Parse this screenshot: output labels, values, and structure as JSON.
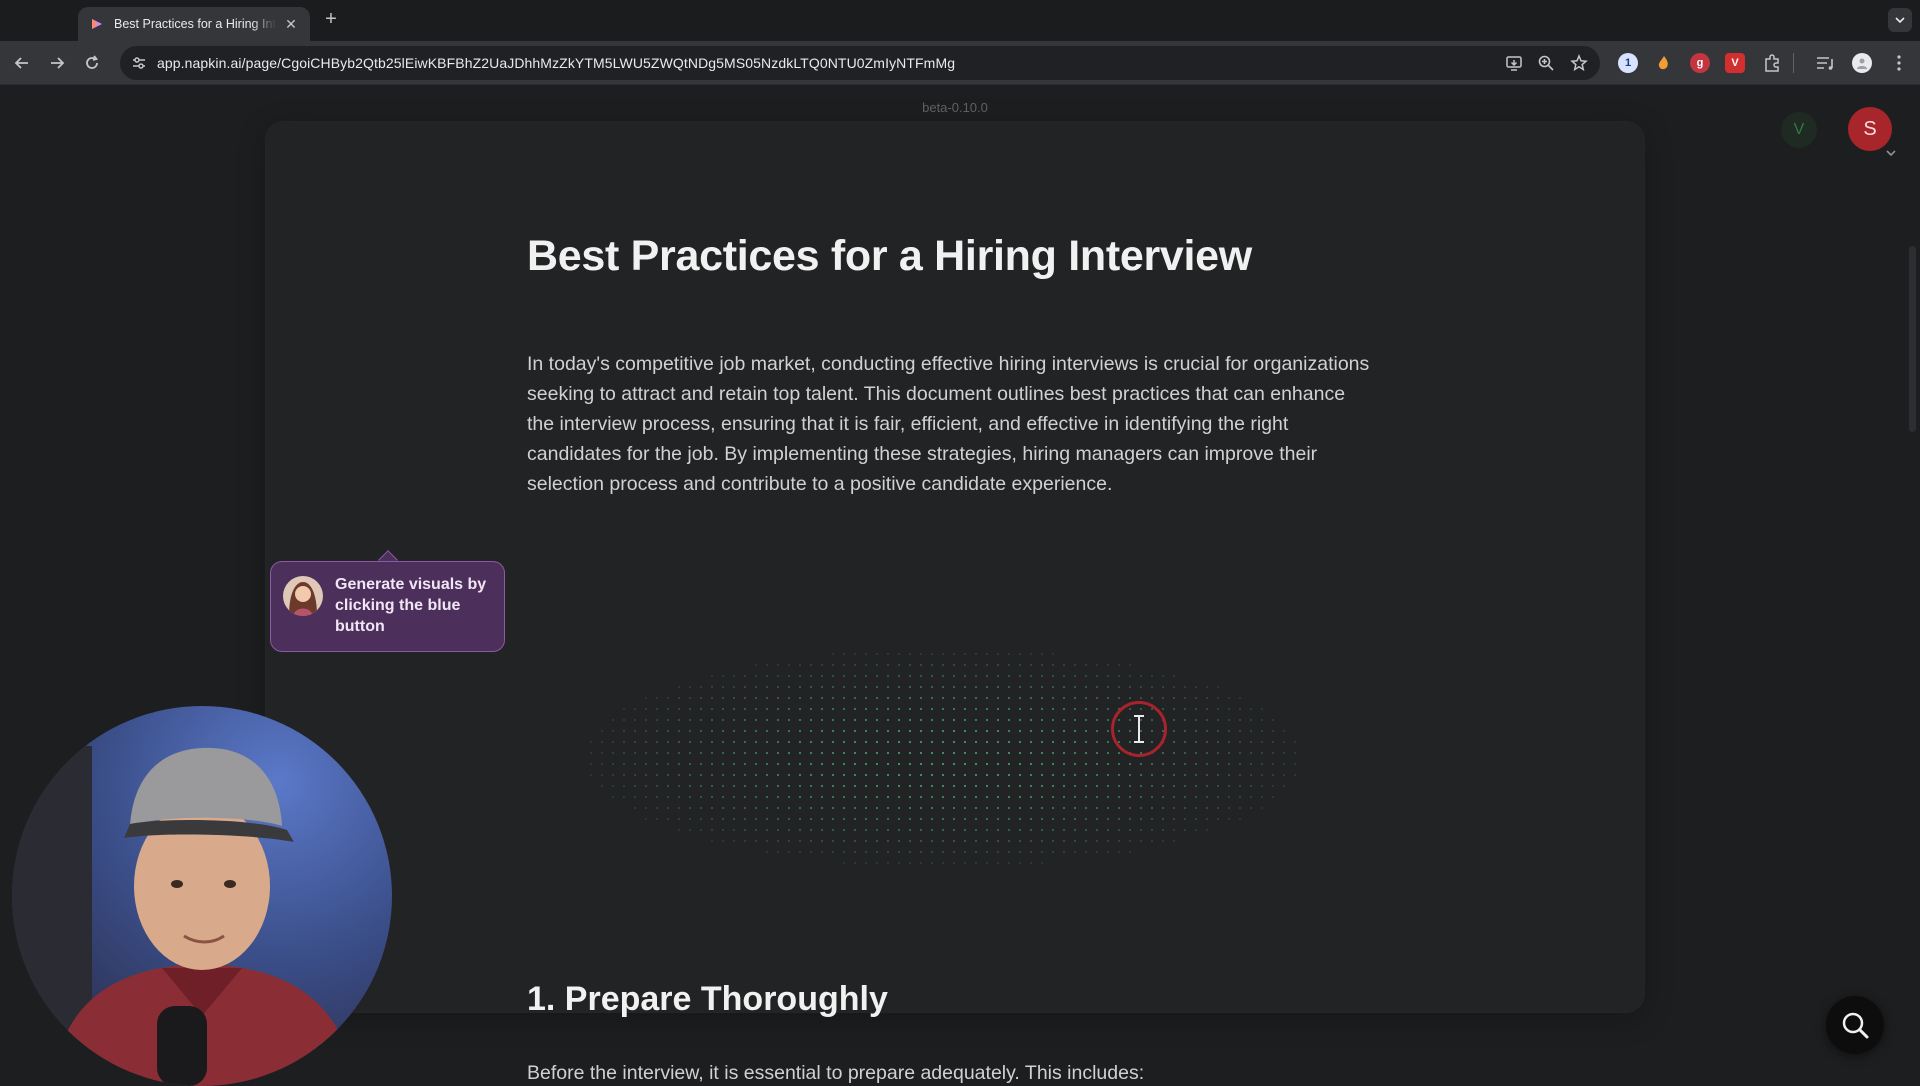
{
  "browser": {
    "tab_title": "Best Practices for a Hiring Interview",
    "url": "app.napkin.ai/page/CgoiCHByb2Qtb25lEiwKBFBhZ2UaJDhhMzZkYTM5LWU5ZWQtNDg5MS05NzdkLTQ0NTU0ZmIyNTFmMg",
    "new_tab_label": "+",
    "close_label": "✕"
  },
  "app": {
    "version": "beta-0.10.0",
    "user_initials": {
      "secondary": "V",
      "primary": "S"
    }
  },
  "document": {
    "title": "Best Practices for a Hiring Interview",
    "intro": "In today's competitive job market, conducting effective hiring interviews is crucial for organizations seeking to attract and retain top talent. This document outlines best practices that can enhance the interview process, ensuring that it is fair, efficient, and effective in identifying the right candidates for the job. By implementing these strategies, hiring managers can improve their selection process and contribute to a positive candidate experience.",
    "section1_heading": "1. Prepare Thoroughly",
    "section1_intro": "Before the interview, it is essential to prepare adequately. This includes:"
  },
  "tooltip": {
    "text": "Generate visuals by clicking the blue button"
  },
  "colors": {
    "accent_purple": "#b45cf0",
    "tooltip_bg": "#4c2f5a",
    "avatar_red": "#a8252c",
    "cursor_ring": "#a8232b"
  },
  "icons": [
    "back-icon",
    "forward-icon",
    "reload-icon",
    "site-info-icon",
    "cast-icon",
    "zoom-icon",
    "bookmark-star-icon",
    "extensions-icon",
    "media-controls-icon",
    "profile-icon",
    "menu-icon",
    "napkin-logo-icon",
    "search-icon"
  ]
}
